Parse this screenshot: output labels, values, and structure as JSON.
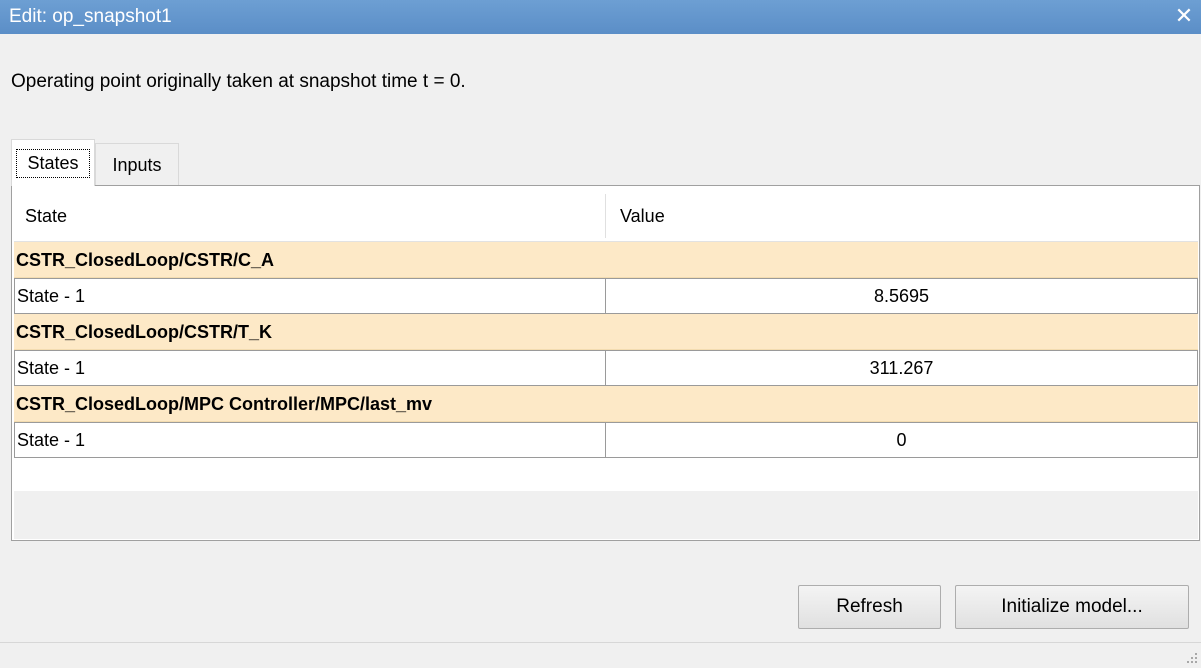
{
  "window": {
    "title": "Edit: op_snapshot1",
    "close_symbol": "✕"
  },
  "info_text": "Operating point originally taken at snapshot time t = 0.",
  "tabs": [
    {
      "label": "States",
      "active": true
    },
    {
      "label": "Inputs",
      "active": false
    }
  ],
  "table": {
    "columns": [
      "State",
      "Value"
    ],
    "groups": [
      {
        "name": "CSTR_ClosedLoop/CSTR/C_A",
        "rows": [
          {
            "state": "State - 1",
            "value": "8.5695"
          }
        ]
      },
      {
        "name": "CSTR_ClosedLoop/CSTR/T_K",
        "rows": [
          {
            "state": "State - 1",
            "value": "311.267"
          }
        ]
      },
      {
        "name": "CSTR_ClosedLoop/MPC Controller/MPC/last_mv",
        "rows": [
          {
            "state": "State - 1",
            "value": "0"
          }
        ]
      }
    ]
  },
  "buttons": {
    "refresh": "Refresh",
    "initialize": "Initialize model..."
  },
  "icons": {
    "close": "close-icon",
    "resize": "resize-grip-icon"
  },
  "colors": {
    "titlebar": "#5f93ca",
    "group_row": "#fde9c7"
  }
}
